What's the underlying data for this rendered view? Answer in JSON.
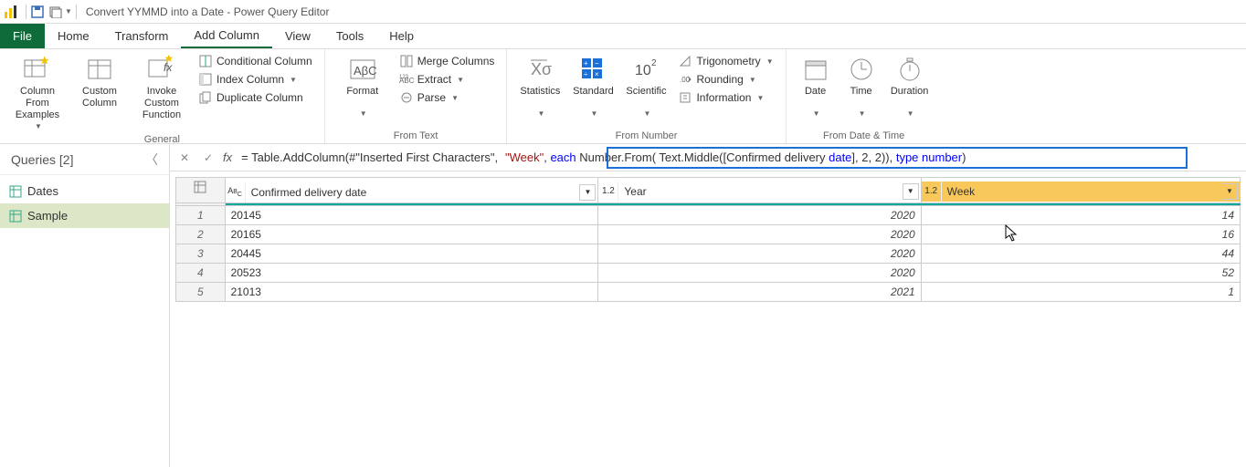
{
  "window": {
    "title": "Convert YYMMD into a Date - Power Query Editor"
  },
  "tabs": {
    "file": "File",
    "home": "Home",
    "transform": "Transform",
    "add_column": "Add Column",
    "view": "View",
    "tools": "Tools",
    "help": "Help"
  },
  "ribbon": {
    "general": {
      "label": "General",
      "column_from_examples": "Column From Examples",
      "custom_column": "Custom Column",
      "invoke_custom_function": "Invoke Custom Function",
      "conditional_column": "Conditional Column",
      "index_column": "Index Column",
      "duplicate_column": "Duplicate Column"
    },
    "from_text": {
      "label": "From Text",
      "format": "Format",
      "merge_columns": "Merge Columns",
      "extract": "Extract",
      "parse": "Parse"
    },
    "from_number": {
      "label": "From Number",
      "statistics": "Statistics",
      "standard": "Standard",
      "scientific": "Scientific",
      "trigonometry": "Trigonometry",
      "rounding": "Rounding",
      "information": "Information"
    },
    "from_datetime": {
      "label": "From Date & Time",
      "date": "Date",
      "time": "Time",
      "duration": "Duration"
    }
  },
  "queries": {
    "header": "Queries [2]",
    "items": [
      {
        "label": "Dates"
      },
      {
        "label": "Sample"
      }
    ]
  },
  "formula": {
    "prefix": "= Table.AddColumn(#\"Inserted First Characters\",",
    "str1": "\"Week\"",
    "comma1": ", ",
    "kw_each": "each",
    "mid1": " Number.From( Text.Middle([Confirmed delivery ",
    "kw_date": "date",
    "mid2": "], 2, 2)), ",
    "kw_type": "type",
    "space": " ",
    "kw_number": "number",
    "close": ")"
  },
  "grid": {
    "col1": {
      "name": "Confirmed delivery date",
      "type_label": "ABC"
    },
    "col2": {
      "name": "Year",
      "type_label": "1.2"
    },
    "col3": {
      "name": "Week",
      "type_label": "1.2"
    },
    "rows": [
      {
        "c1": "20145",
        "c2": "2020",
        "c3": "14"
      },
      {
        "c1": "20165",
        "c2": "2020",
        "c3": "16"
      },
      {
        "c1": "20445",
        "c2": "2020",
        "c3": "44"
      },
      {
        "c1": "20523",
        "c2": "2020",
        "c3": "52"
      },
      {
        "c1": "21013",
        "c2": "2021",
        "c3": "1"
      }
    ]
  }
}
